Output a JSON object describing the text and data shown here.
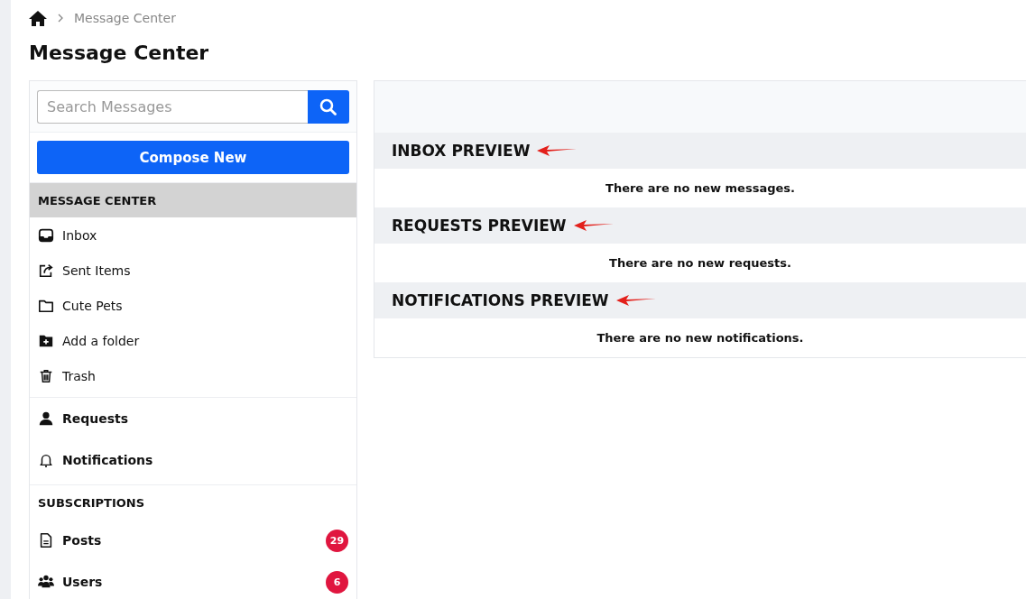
{
  "breadcrumb": {
    "items": [
      "Message Center"
    ]
  },
  "title": "Message Center",
  "sidebar": {
    "search": {
      "placeholder": "Search Messages"
    },
    "compose_button": "Compose New",
    "sections": [
      {
        "heading": "MESSAGE CENTER",
        "shaded": true,
        "bold": false,
        "items": [
          {
            "label": "Inbox",
            "kind": "inbox"
          },
          {
            "label": "Sent Items",
            "kind": "sent"
          },
          {
            "label": "Cute Pets",
            "kind": "folder"
          },
          {
            "label": "Add a folder",
            "kind": "add-folder"
          },
          {
            "label": "Trash",
            "kind": "trash"
          }
        ]
      },
      {
        "bold": true,
        "items": [
          {
            "label": "Requests",
            "kind": "person"
          },
          {
            "label": "Notifications",
            "kind": "bell"
          }
        ]
      },
      {
        "heading": "SUBSCRIPTIONS",
        "shaded": false,
        "bold": true,
        "items": [
          {
            "label": "Posts",
            "kind": "document",
            "badge": "29"
          },
          {
            "label": "Users",
            "kind": "users",
            "badge": "6"
          }
        ]
      }
    ]
  },
  "previews": [
    {
      "title": "INBOX PREVIEW",
      "message": "There are no new messages."
    },
    {
      "title": "REQUESTS PREVIEW",
      "message": "There are no new requests."
    },
    {
      "title": "NOTIFICATIONS PREVIEW",
      "message": "There are no new notifications."
    }
  ]
}
